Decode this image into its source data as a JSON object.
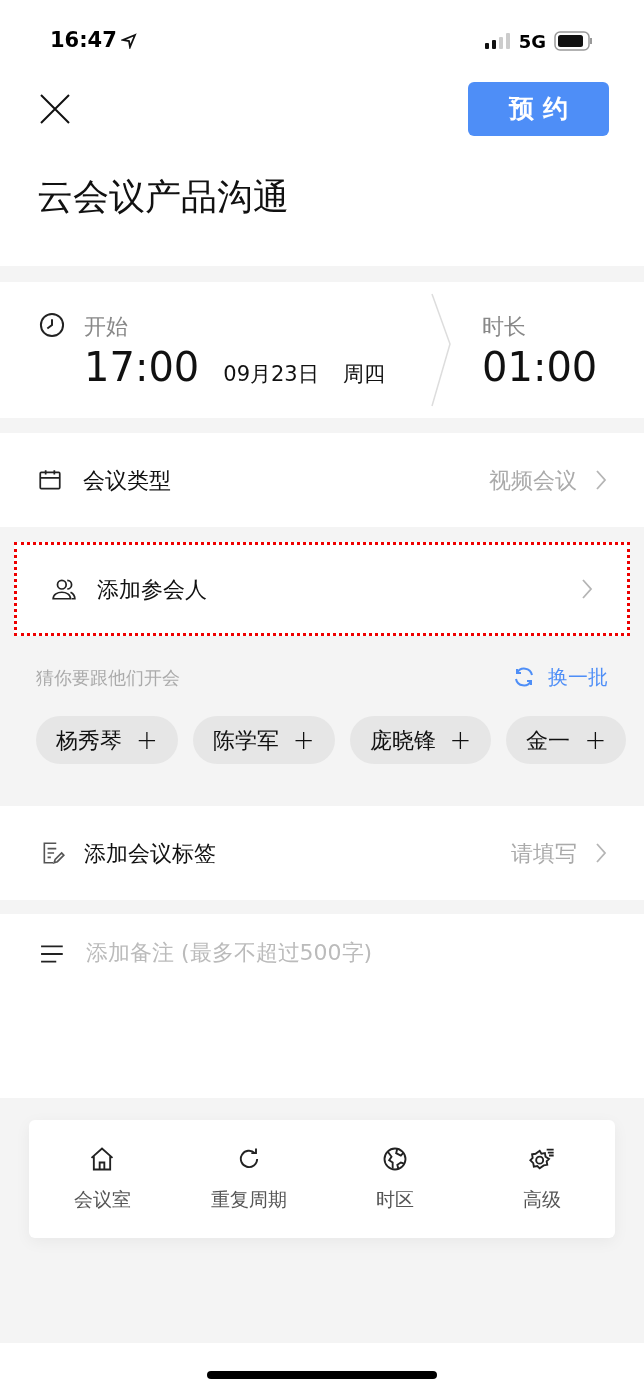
{
  "status_bar": {
    "time": "16:47",
    "network": "5G"
  },
  "header": {
    "book_button": "预 约"
  },
  "title": "云会议产品沟通",
  "schedule": {
    "start_label": "开始",
    "start_time": "17:00",
    "date": "09月23日",
    "weekday": "周四",
    "duration_label": "时长",
    "duration": "01:00"
  },
  "rows": [
    {
      "kind": "type",
      "label": "会议类型",
      "value": "视频会议",
      "highlighted": false
    },
    {
      "kind": "attendees",
      "label": "添加参会人",
      "highlighted": true
    }
  ],
  "suggestions": {
    "hint": "猜你要跟他们开会",
    "refresh": "换一批",
    "people": [
      {
        "name": "杨秀琴",
        "add": "+"
      },
      {
        "name": "陈学军",
        "add": "+"
      },
      {
        "name": "庞晓锋",
        "add": "+"
      },
      {
        "name": "金一",
        "add": "+"
      }
    ]
  },
  "tag_row": {
    "label": "添加会议标签",
    "value": "请填写"
  },
  "notes": {
    "placeholder": "添加备注 (最多不超过500字)"
  },
  "toolbar": [
    {
      "kind": "room",
      "label": "会议室"
    },
    {
      "kind": "repeat",
      "label": "重复周期"
    },
    {
      "kind": "timezone",
      "label": "时区"
    },
    {
      "kind": "advanced",
      "label": "高级"
    }
  ]
}
